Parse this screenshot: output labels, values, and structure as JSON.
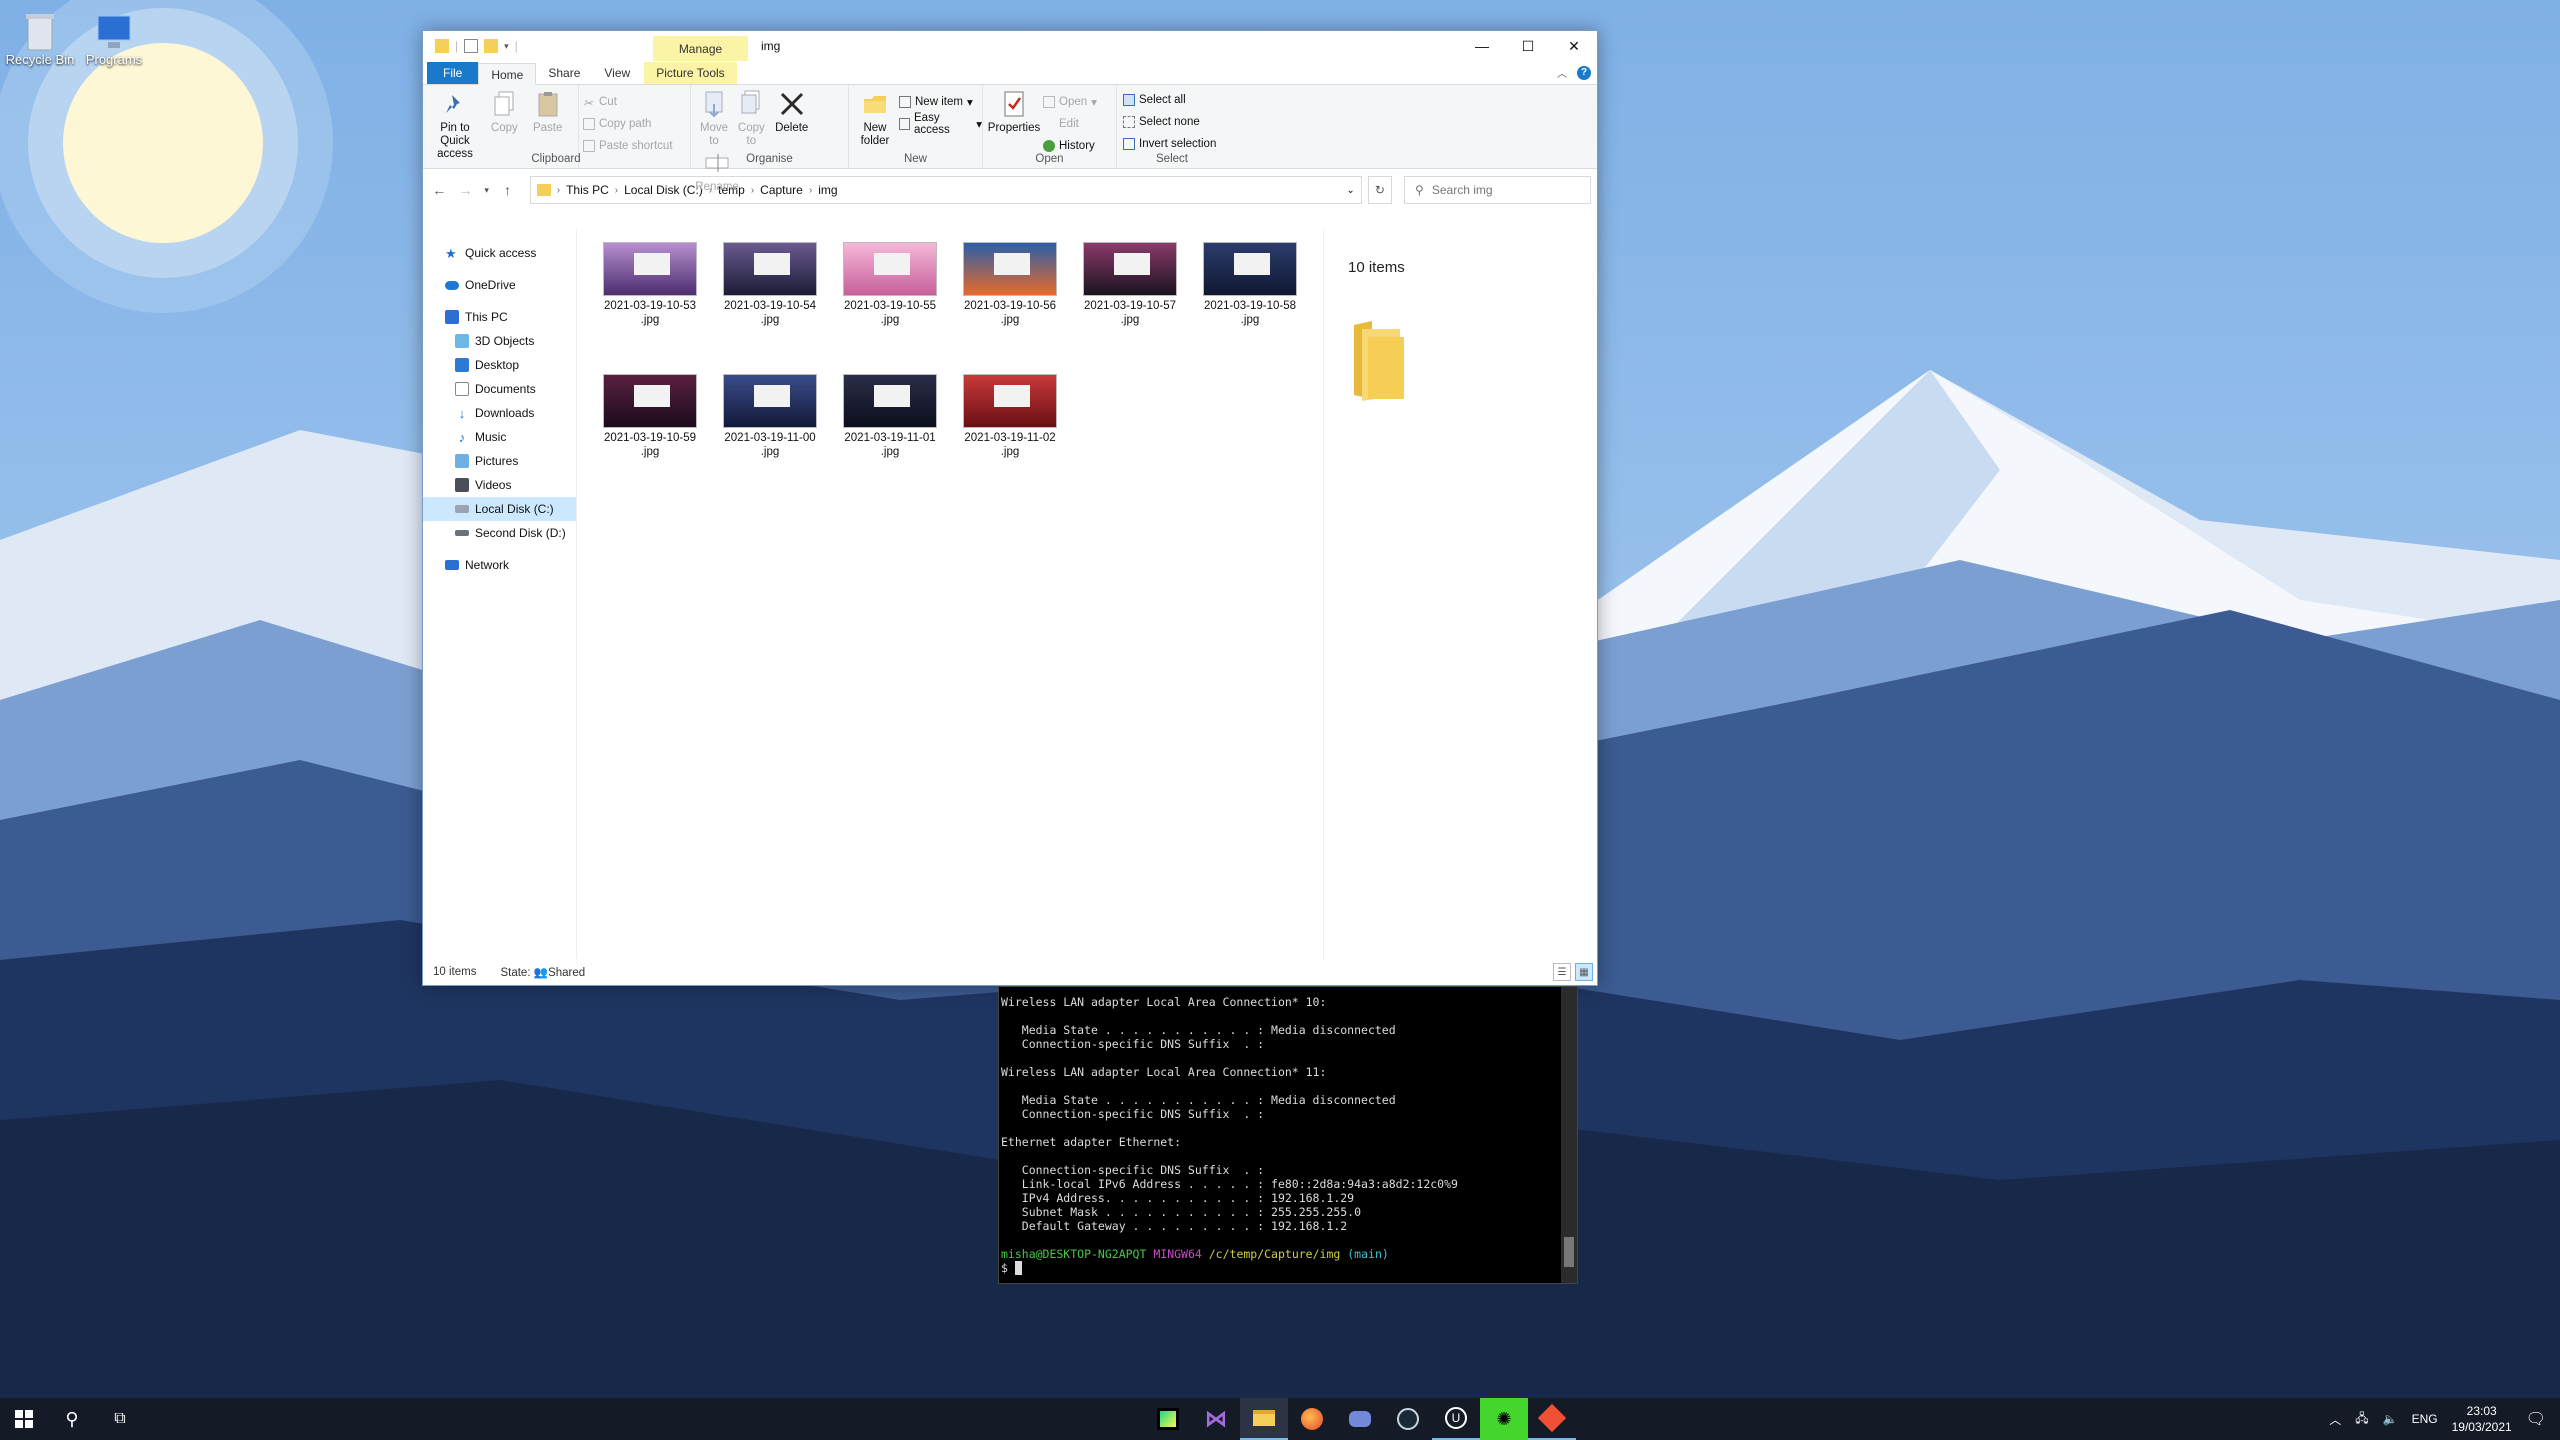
{
  "desktop": {
    "icons": [
      {
        "label": "Recycle Bin"
      },
      {
        "label": "Programs"
      }
    ]
  },
  "explorer": {
    "title": "img",
    "contextual_tab_header": "Manage",
    "tabs": [
      "File",
      "Home",
      "Share",
      "View",
      "Picture Tools"
    ],
    "active_tab": "Home",
    "window_controls": [
      "minimize",
      "maximize",
      "close"
    ],
    "ribbon": {
      "clipboard": {
        "label": "Clipboard",
        "pin": "Pin to Quick access",
        "copy": "Copy",
        "paste": "Paste",
        "cut": "Cut",
        "copy_path": "Copy path",
        "paste_shortcut": "Paste shortcut"
      },
      "organise": {
        "label": "Organise",
        "move_to": "Move to",
        "copy_to": "Copy to",
        "delete": "Delete",
        "rename": "Rename"
      },
      "new": {
        "label": "New",
        "new_folder": "New folder",
        "new_item": "New item",
        "easy_access": "Easy access"
      },
      "open": {
        "label": "Open",
        "properties": "Properties",
        "open": "Open",
        "edit": "Edit",
        "history": "History"
      },
      "select": {
        "label": "Select",
        "select_all": "Select all",
        "select_none": "Select none",
        "invert": "Invert selection"
      }
    },
    "address": {
      "crumbs": [
        "This PC",
        "Local Disk (C:)",
        "temp",
        "Capture",
        "img"
      ],
      "search_placeholder": "Search img"
    },
    "nav": {
      "quick_access": "Quick access",
      "onedrive": "OneDrive",
      "this_pc": "This PC",
      "items": [
        "3D Objects",
        "Desktop",
        "Documents",
        "Downloads",
        "Music",
        "Pictures",
        "Videos",
        "Local Disk (C:)",
        "Second Disk (D:)"
      ],
      "network": "Network"
    },
    "files": [
      {
        "l1": "2021-03-19-10-53",
        "l2": ".jpg",
        "c1": "#b78fd0",
        "c2": "#4c2d6e"
      },
      {
        "l1": "2021-03-19-10-54",
        "l2": ".jpg",
        "c1": "#6b5a8f",
        "c2": "#1b1b36"
      },
      {
        "l1": "2021-03-19-10-55",
        "l2": ".jpg",
        "c1": "#f5b8d8",
        "c2": "#c7609b"
      },
      {
        "l1": "2021-03-19-10-56",
        "l2": ".jpg",
        "c1": "#2a5ea8",
        "c2": "#e86a2a"
      },
      {
        "l1": "2021-03-19-10-57",
        "l2": ".jpg",
        "c1": "#8b3a6a",
        "c2": "#1a1320"
      },
      {
        "l1": "2021-03-19-10-58",
        "l2": ".jpg",
        "c1": "#2c3c6e",
        "c2": "#0f1830"
      },
      {
        "l1": "2021-03-19-10-59",
        "l2": ".jpg",
        "c1": "#5a2040",
        "c2": "#1a0c1a"
      },
      {
        "l1": "2021-03-19-11-00",
        "l2": ".jpg",
        "c1": "#3a4c8a",
        "c2": "#121a3a"
      },
      {
        "l1": "2021-03-19-11-01",
        "l2": ".jpg",
        "c1": "#2a2e48",
        "c2": "#0c0e1c"
      },
      {
        "l1": "2021-03-19-11-02",
        "l2": ".jpg",
        "c1": "#c83a3a",
        "c2": "#6a0f14"
      }
    ],
    "preview_count": "10 items",
    "status": {
      "count": "10 items",
      "state_label": "State:",
      "state_value": "Shared"
    }
  },
  "terminal": {
    "lines": [
      {
        "t": "Wireless LAN adapter Local Area Connection* 10:"
      },
      {
        "t": ""
      },
      {
        "t": "   Media State . . . . . . . . . . . : Media disconnected"
      },
      {
        "t": "   Connection-specific DNS Suffix  . :"
      },
      {
        "t": ""
      },
      {
        "t": "Wireless LAN adapter Local Area Connection* 11:"
      },
      {
        "t": ""
      },
      {
        "t": "   Media State . . . . . . . . . . . : Media disconnected"
      },
      {
        "t": "   Connection-specific DNS Suffix  . :"
      },
      {
        "t": ""
      },
      {
        "t": "Ethernet adapter Ethernet:"
      },
      {
        "t": ""
      },
      {
        "t": "   Connection-specific DNS Suffix  . :"
      },
      {
        "t": "   Link-local IPv6 Address . . . . . : fe80::2d8a:94a3:a8d2:12c0%9"
      },
      {
        "t": "   IPv4 Address. . . . . . . . . . . : 192.168.1.29"
      },
      {
        "t": "   Subnet Mask . . . . . . . . . . . : 255.255.255.0"
      },
      {
        "t": "   Default Gateway . . . . . . . . . : 192.168.1.2"
      },
      {
        "t": ""
      }
    ],
    "prompt_user": "misha@DESKTOP-NG2APQT",
    "prompt_env": "MINGW64",
    "prompt_path": "/c/temp/Capture/img",
    "prompt_branch": "(main)",
    "prompt_symbol": "$"
  },
  "taskbar": {
    "apps": [
      "start-icon",
      "search-icon",
      "task-view-icon",
      "pycharm-icon",
      "visual-studio-icon",
      "file-explorer-icon",
      "firefox-icon",
      "discord-icon",
      "steam-icon",
      "unreal-icon",
      "razer-icon",
      "git-icon"
    ],
    "language": "ENG",
    "time": "23:03",
    "date": "19/03/2021"
  }
}
